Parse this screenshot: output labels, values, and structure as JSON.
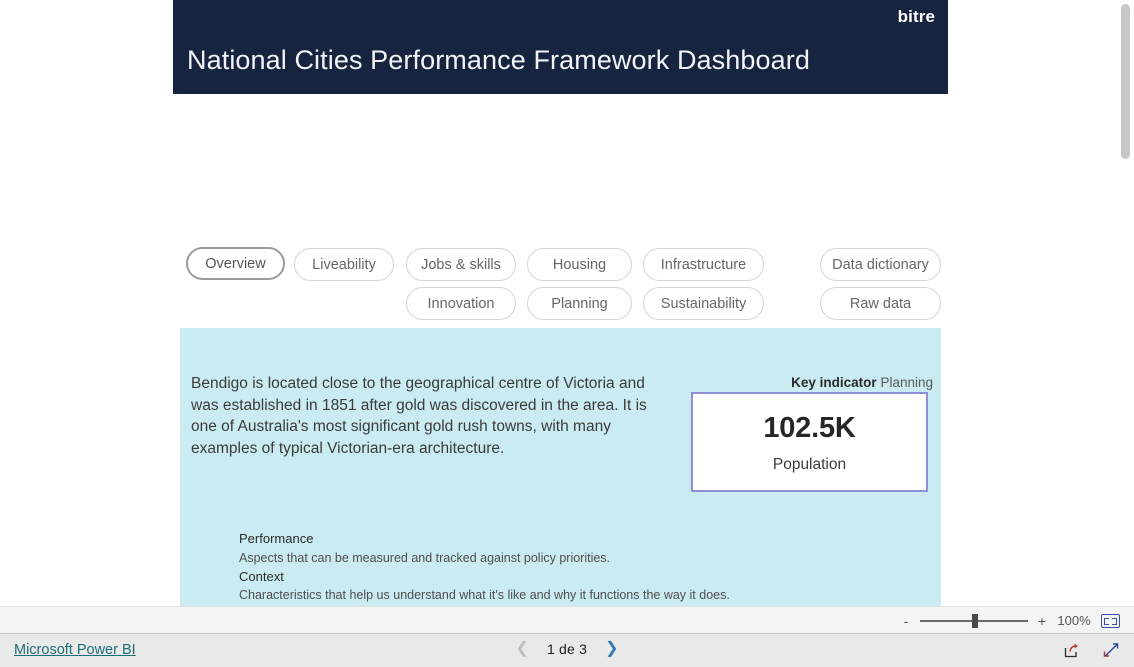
{
  "header": {
    "brand": "bitre",
    "title": "National Cities Performance Framework Dashboard",
    "background_color": "#16243f"
  },
  "nav": {
    "pills": [
      {
        "label": "Overview",
        "selected": true
      },
      {
        "label": "Liveability",
        "selected": false
      },
      {
        "label": "Jobs & skills",
        "selected": false
      },
      {
        "label": "Housing",
        "selected": false
      },
      {
        "label": "Infrastructure",
        "selected": false
      },
      {
        "label": "Data dictionary",
        "selected": false
      },
      {
        "label": "Innovation",
        "selected": false
      },
      {
        "label": "Planning",
        "selected": false
      },
      {
        "label": "Sustainability",
        "selected": false
      },
      {
        "label": "Raw data",
        "selected": false
      }
    ]
  },
  "content": {
    "panel_color": "#c9ebf1",
    "description": "Bendigo is located close to the geographical centre of Victoria and was established in 1851 after gold was discovered in the area. It is one of Australia's most significant gold rush towns, with many examples of typical Victorian-era architecture.",
    "key_indicator": {
      "label_bold": "Key indicator",
      "label_category": "Planning",
      "value": "102.5K",
      "caption": "Population",
      "border_color": "#8f8fd8"
    },
    "legend": {
      "performance_term": "Performance",
      "performance_definition": "Aspects that can be measured and tracked against policy priorities.",
      "context_term": "Context",
      "context_definition": "Characteristics that help us understand what it's like and why it functions the way it does."
    }
  },
  "zoom_bar": {
    "minus": "-",
    "plus": "+",
    "percent": "100%"
  },
  "footer": {
    "powerbi_link": "Microsoft Power BI",
    "link_color": "#1a6e78",
    "page_text": "1 de 3"
  }
}
